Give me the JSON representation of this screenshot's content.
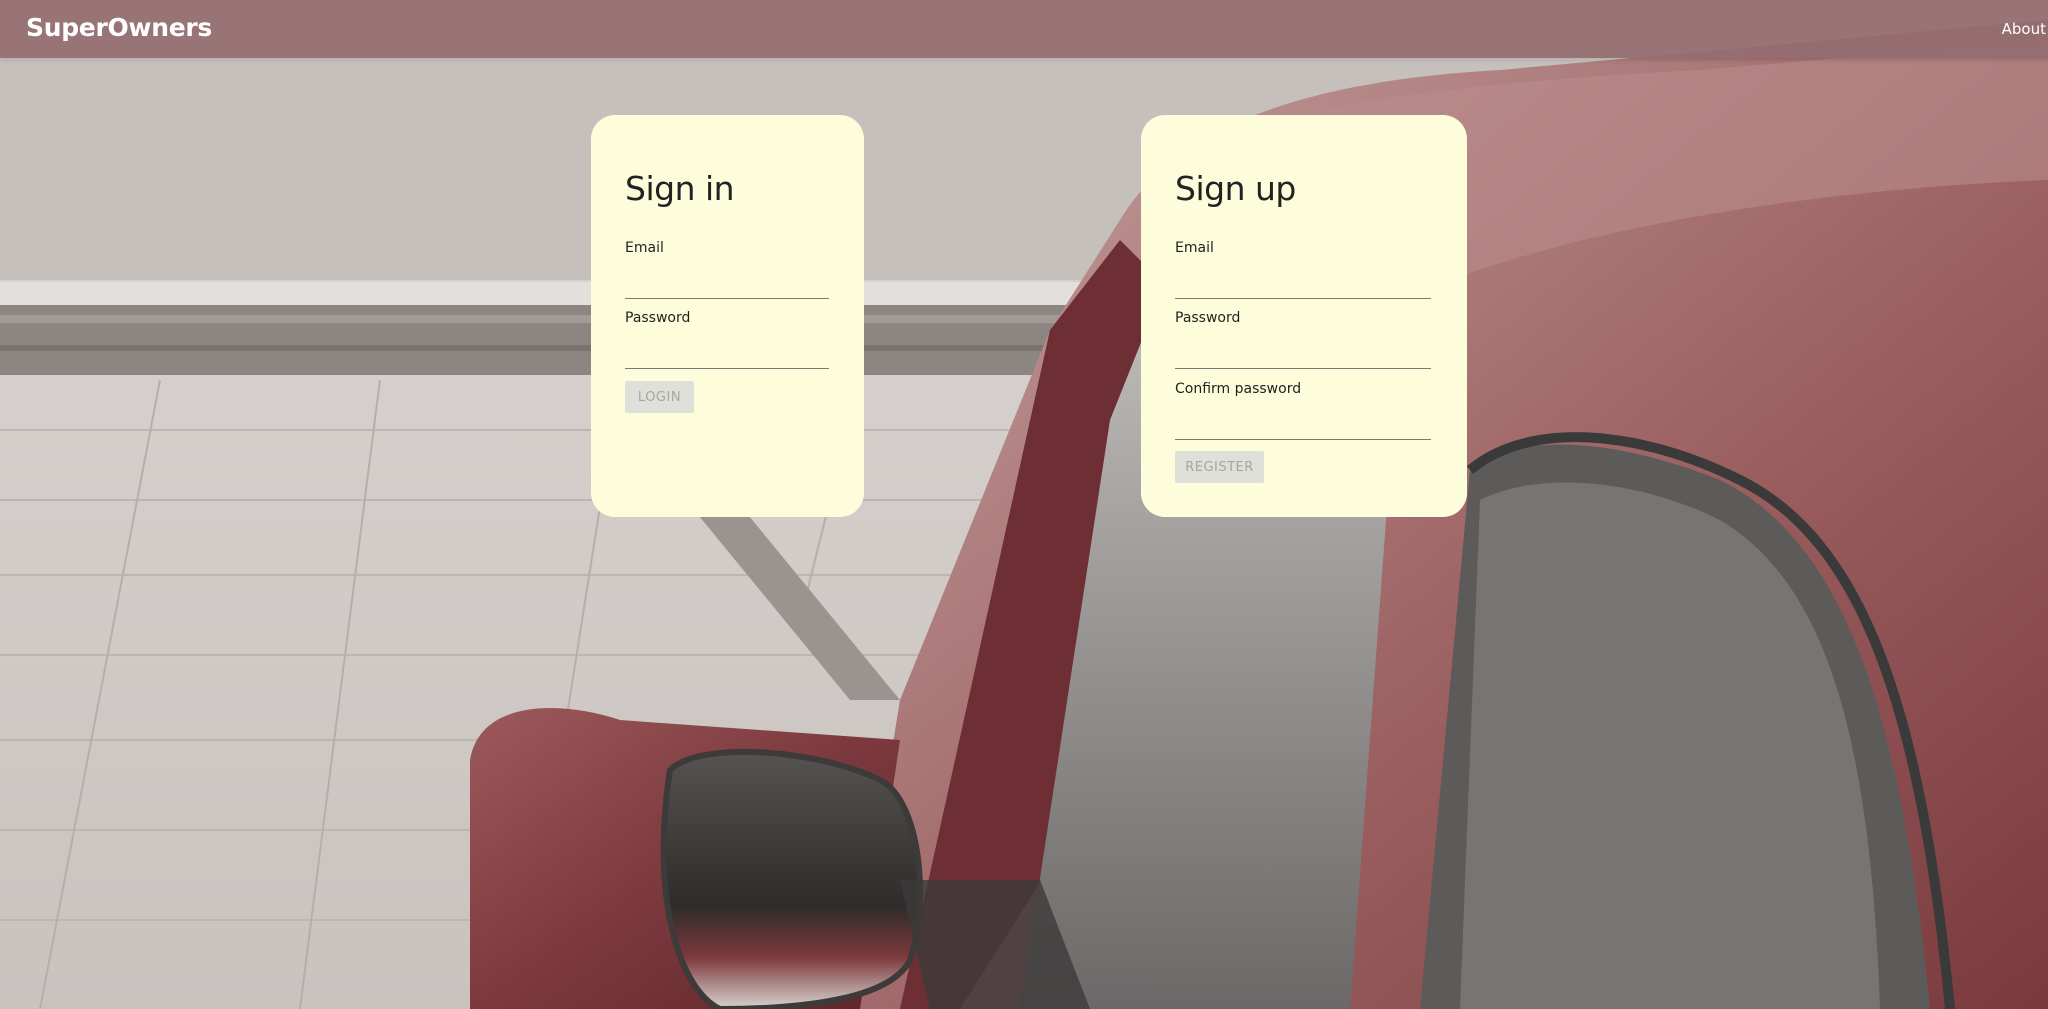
{
  "navbar": {
    "brand": "SuperOwners",
    "links": [
      {
        "label": "About"
      }
    ]
  },
  "signin": {
    "title": "Sign in",
    "fields": [
      {
        "label": "Email",
        "value": "",
        "type": "email"
      },
      {
        "label": "Password",
        "value": "",
        "type": "password"
      }
    ],
    "button_label": "LOGIN",
    "button_disabled": true
  },
  "signup": {
    "title": "Sign up",
    "fields": [
      {
        "label": "Email",
        "value": "",
        "type": "email"
      },
      {
        "label": "Password",
        "value": "",
        "type": "password"
      },
      {
        "label": "Confirm password",
        "value": "",
        "type": "password"
      }
    ],
    "button_label": "REGISTER",
    "button_disabled": true
  },
  "colors": {
    "navbar": "#946c70",
    "card": "#fdfddb",
    "button_disabled_bg": "#e0e0da",
    "button_disabled_text": "#a6a6a2",
    "text": "#222222"
  }
}
